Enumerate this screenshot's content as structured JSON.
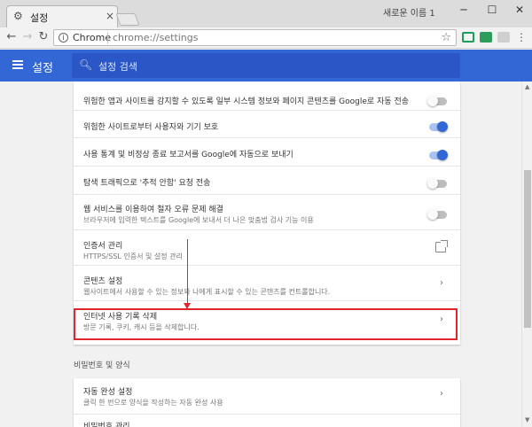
{
  "tab": {
    "title": "설정",
    "icon": "gear-icon",
    "close_glyph": "×"
  },
  "window": {
    "user": "새로운 이름 1",
    "minimize": "─",
    "maximize": "☐",
    "close": "✕"
  },
  "toolbar": {
    "back": "←",
    "forward": "→",
    "reload": "↻",
    "site_label": "Chrome",
    "url": "chrome://settings",
    "star": "☆"
  },
  "appbar": {
    "title": "설정",
    "search_placeholder": "설정 검색"
  },
  "privacy_rows": [
    {
      "title": "위험한 앱과 사이트를 감지할 수 있도록 일부 시스템 정보와 페이지 콘텐츠를 Google로 자동 전송",
      "toggle": "off"
    },
    {
      "title": "위험한 사이트로부터 사용자와 기기 보호",
      "toggle": "on"
    },
    {
      "title": "사용 통계 및 비정상 종료 보고서를 Google에 자동으로 보내기",
      "toggle": "on"
    },
    {
      "title": "탐색 트래픽으로 '추적 안함' 요청 전송",
      "toggle": "off"
    },
    {
      "title": "웹 서비스를 이용하여 철자 오류 문제 해결",
      "sub": "브라우저에 입력한 텍스트를 Google에 보내서 더 나은 맞춤법 검사 기능 이용",
      "toggle": "off"
    },
    {
      "title": "인증서 관리",
      "sub": "HTTPS/SSL 인증서 및 설정 관리"
    },
    {
      "title": "콘텐츠 설정",
      "sub": "웹사이트에서 사용할 수 있는 정보와 나에게 표시할 수 있는 콘텐츠를 컨트롤합니다."
    },
    {
      "title": "인터넷 사용 기록 삭제",
      "sub": "방문 기록, 쿠키, 캐시 등을 삭제합니다."
    }
  ],
  "passwords_section": {
    "heading": "비밀번호 및 양식",
    "rows": [
      {
        "title": "자동 완성 설정",
        "sub": "클릭 한 번으로 양식을 작성하는 자동 완성 사용"
      },
      {
        "title": "비밀번호 관리"
      }
    ]
  },
  "colors": {
    "accent": "#3367d6",
    "highlight": "#e0252b"
  }
}
